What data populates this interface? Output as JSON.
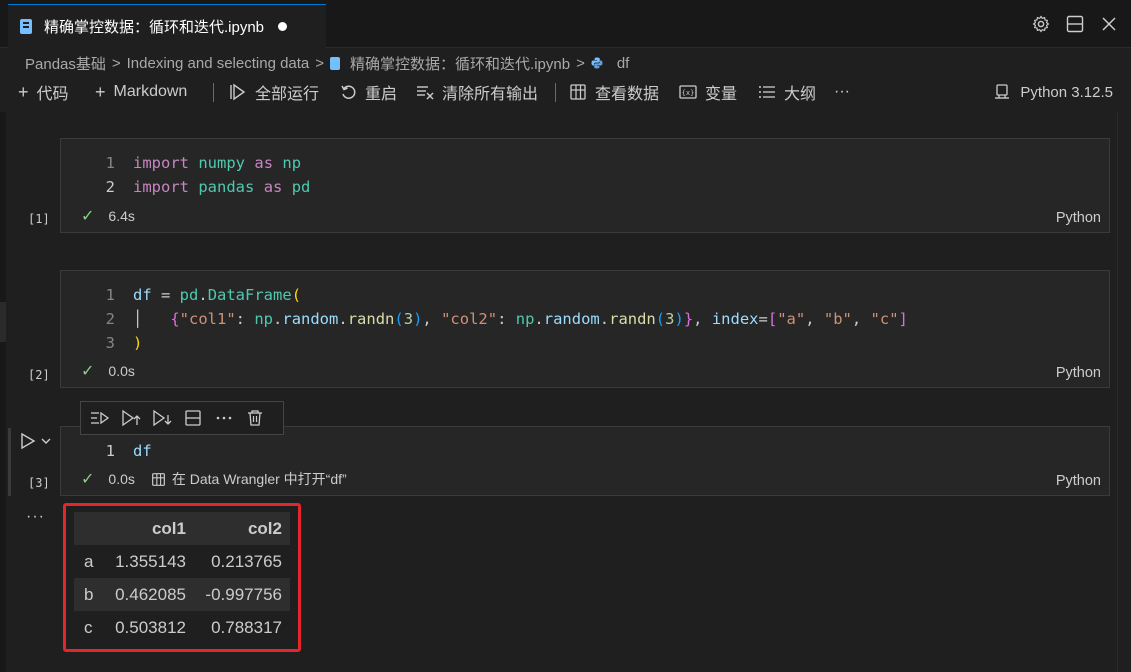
{
  "tab": {
    "title": "精确掌控数据：循环和迭代.ipynb"
  },
  "icons": {
    "tab_actions": [
      "settings-gear-icon",
      "split-editor-icon",
      "close-icon"
    ],
    "cell_toolbar": [
      "run-above-icon",
      "run-cell-and-below-icon",
      "execute-below-icon",
      "split-cell-icon",
      "more-icon",
      "delete-icon"
    ]
  },
  "breadcrumb": {
    "items": [
      "Pandas基础",
      "Indexing and selecting data",
      "精确掌控数据：循环和迭代.ipynb",
      "df"
    ],
    "separator": ">"
  },
  "toolbar": {
    "add_code": "代码",
    "add_markdown": "Markdown",
    "run_all": "全部运行",
    "restart": "重启",
    "clear_outputs": "清除所有输出",
    "view_data": "查看数据",
    "variables": "变量",
    "outline": "大纲",
    "more": "···",
    "kernel": "Python 3.12.5"
  },
  "cells": [
    {
      "exec_count": "[1]",
      "line_numbers": [
        "1",
        "2"
      ],
      "status_time": "6.4s",
      "language": "Python"
    },
    {
      "exec_count": "[2]",
      "line_numbers": [
        "1",
        "2",
        "3"
      ],
      "status_time": "0.0s",
      "language": "Python"
    },
    {
      "exec_count": "[3]",
      "line_numbers": [
        "1"
      ],
      "code": "df",
      "status_time": "0.0s",
      "data_wrangler_link": "在 Data Wrangler 中打开“df”",
      "language": "Python"
    }
  ],
  "output": {
    "ellipsis": "···",
    "columns": [
      "",
      "col1",
      "col2"
    ],
    "rows": [
      {
        "index": "a",
        "col1": "1.355143",
        "col2": "0.213765"
      },
      {
        "index": "b",
        "col1": "0.462085",
        "col2": "-0.997756"
      },
      {
        "index": "c",
        "col1": "0.503812",
        "col2": "0.788317"
      }
    ]
  },
  "colors": {
    "highlight_frame": "#e3262c",
    "success_check": "#89d185",
    "tab_accent": "#0078d4"
  }
}
